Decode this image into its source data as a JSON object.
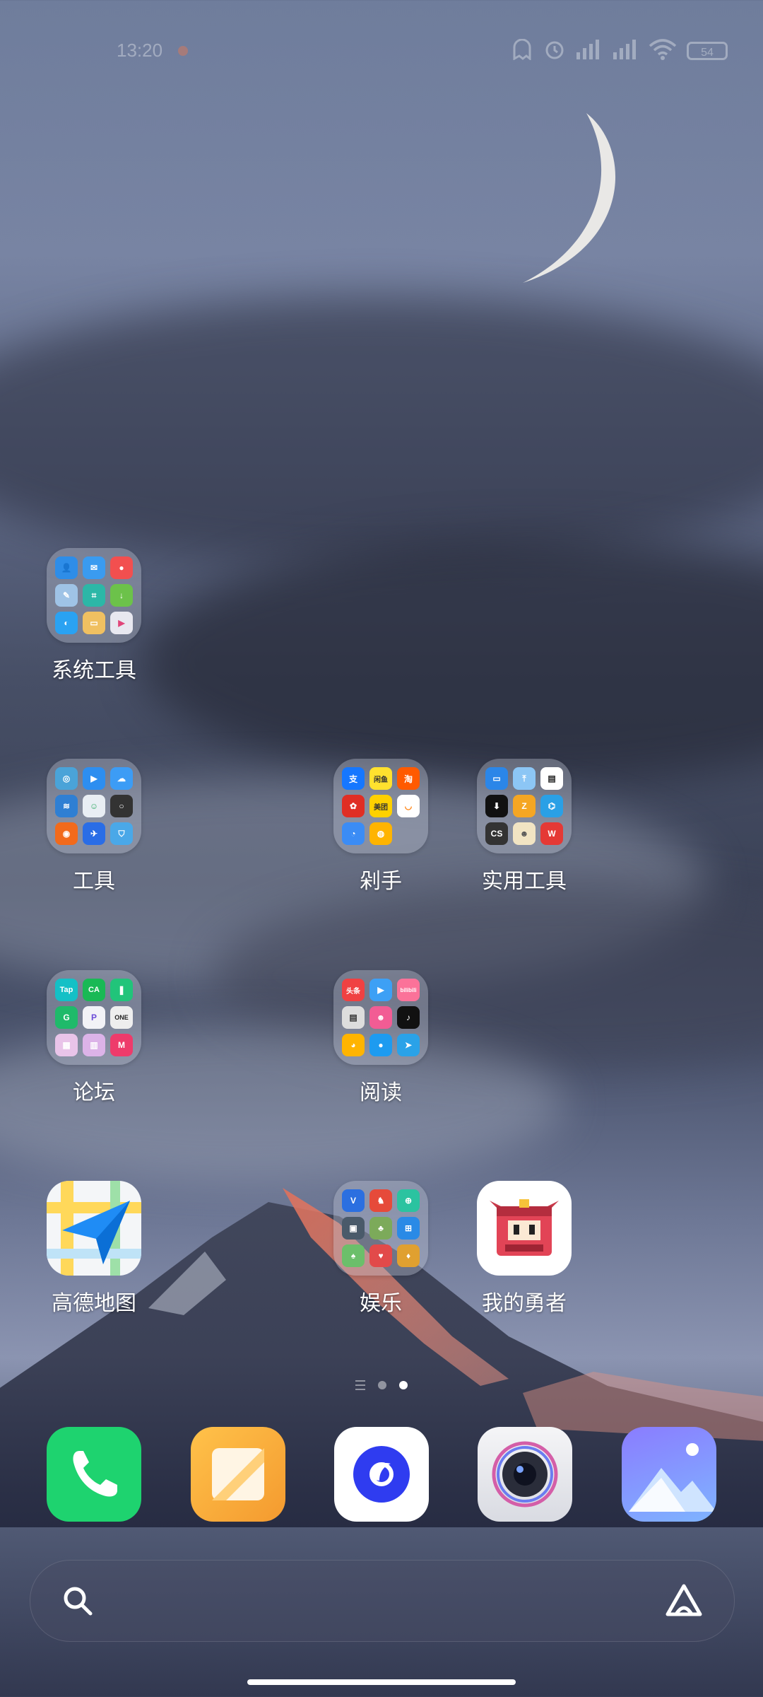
{
  "status_bar": {
    "time": "13:20",
    "battery": "54"
  },
  "apps": {
    "system_tools": "系统工具",
    "tools": "工具",
    "shopping": "剁手",
    "utility_tools": "实用工具",
    "forum": "论坛",
    "reading": "阅读",
    "amap": "高德地图",
    "entertainment": "娱乐",
    "my_hero": "我的勇者"
  },
  "folder_minis": {
    "forum": [
      "Tap",
      "CA",
      "",
      "G",
      "P",
      "ONE",
      "",
      "",
      "M"
    ],
    "reading": [
      "头条",
      "",
      "bilibili",
      "",
      "",
      "",
      "",
      "",
      ""
    ],
    "shopping": [
      "支",
      "闲鱼",
      "淘",
      "",
      "美团",
      "",
      "",
      "",
      ""
    ],
    "utility": [
      "",
      "",
      "",
      "",
      "",
      "",
      "CS",
      "",
      "W"
    ]
  },
  "dock": [
    "phone",
    "notes",
    "browser",
    "camera",
    "gallery"
  ],
  "page_indicator": {
    "pages": 2,
    "active": 2
  },
  "colors": {
    "accent_green": "#1ed36f",
    "notes_orange": "#f7a93b",
    "browser_blue": "#2f3cf0",
    "gallery_blue": "#7fa8ff"
  }
}
